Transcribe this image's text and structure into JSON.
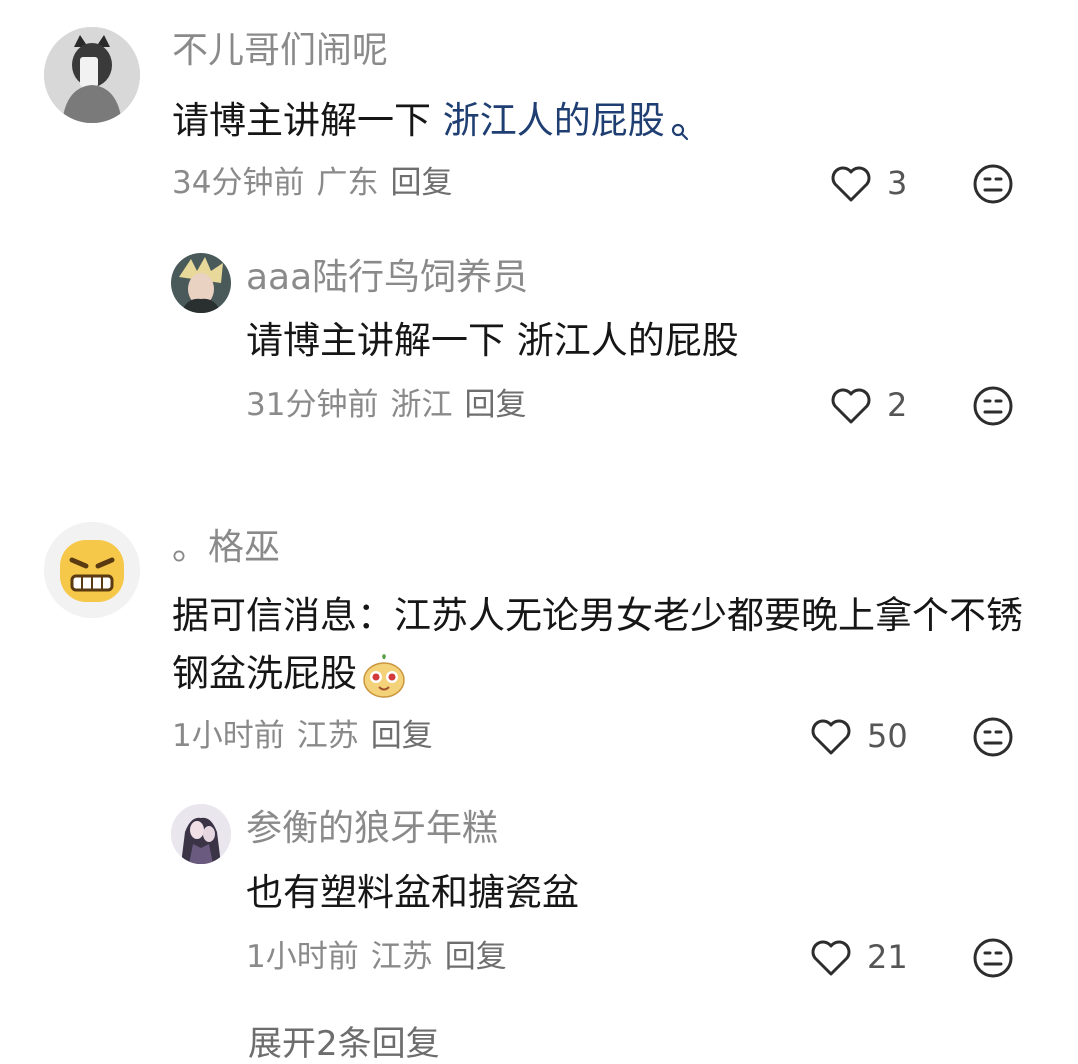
{
  "comments": [
    {
      "name": "不儿哥们闹呢",
      "text_prefix": "请博主讲解一下 ",
      "text_link": "浙江人的屁股",
      "time": "34分钟前",
      "location": "广东",
      "reply": "回复",
      "likes": "3",
      "link_icon": "search-icon",
      "replies": [
        {
          "name": "aaa陆行鸟饲养员",
          "text": "请博主讲解一下 浙江人的屁股",
          "time": "31分钟前",
          "location": "浙江",
          "reply": "回复",
          "likes": "2"
        }
      ]
    },
    {
      "name": "。格巫",
      "text": "据可信消息：江苏人无论男女老少都要晚上拿个不锈钢盆洗屁股",
      "text_emoji": "cute-monster-emoji",
      "time": "1小时前",
      "location": "江苏",
      "reply": "回复",
      "likes": "50",
      "replies": [
        {
          "name": "参衡的狼牙年糕",
          "text": "也有塑料盆和搪瓷盆",
          "time": "1小时前",
          "location": "江苏",
          "reply": "回复",
          "likes": "21"
        }
      ]
    }
  ],
  "more_replies": "展开2条回复",
  "colors": {
    "link": "#1f3f73",
    "meta": "#8a8a8a",
    "text": "#161616"
  }
}
